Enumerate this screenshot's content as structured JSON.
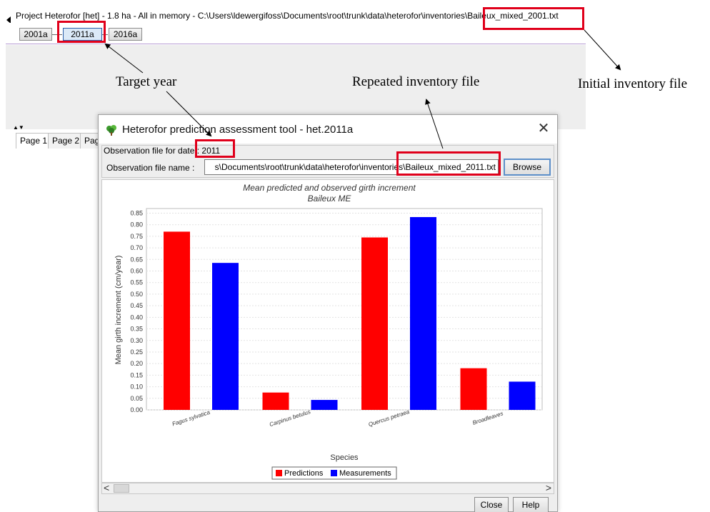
{
  "main_window": {
    "title": "Project Heterofor [het] - 1.8 ha - All in memory - C:\\Users\\ldewergifoss\\Documents\\root\\trunk\\data\\heterofor\\inventories\\Baileux_mixed_2001.txt",
    "steps": [
      "2001a",
      "2011a",
      "2016a"
    ],
    "page_tabs": [
      "Page 1",
      "Page 2",
      "Pag"
    ]
  },
  "annotations": {
    "target_year": "Target year",
    "repeated_file": "Repeated inventory file",
    "initial_file": "Initial inventory file"
  },
  "dialog": {
    "title": "Heterofor prediction assessment tool - het.2011a",
    "close_glyph": "✕",
    "obs_date_label": "Observation file for date",
    "obs_date_value": ": 2011",
    "obs_name_label": "Observation file name :",
    "obs_name_value": "s\\Documents\\root\\trunk\\data\\heterofor\\inventories\\Baileux_mixed_2011.txt",
    "browse_label": "Browse",
    "close_label": "Close",
    "help_label": "Help",
    "scroll_left": "<",
    "scroll_right": ">"
  },
  "icons": {
    "app": "tree-icon",
    "close": "close-icon"
  },
  "colors": {
    "predictions": "#ff0000",
    "measurements": "#0000ff",
    "annotation_box": "#e0001b"
  },
  "chart_data": {
    "type": "bar",
    "title": "Mean predicted and observed girth increment",
    "subtitle": "Baileux ME",
    "xlabel": "Species",
    "ylabel": "Mean girth increment (cm/year)",
    "ylim": [
      0,
      0.87
    ],
    "yticks": [
      "0.00",
      "0.05",
      "0.10",
      "0.15",
      "0.20",
      "0.25",
      "0.30",
      "0.35",
      "0.40",
      "0.45",
      "0.50",
      "0.55",
      "0.60",
      "0.65",
      "0.70",
      "0.75",
      "0.80",
      "0.85"
    ],
    "categories": [
      "Fagus sylvatica",
      "Carpinus betulus",
      "Quercus petraea",
      "Broadleaves"
    ],
    "series": [
      {
        "name": "Predictions",
        "values": [
          0.77,
          0.075,
          0.745,
          0.18
        ]
      },
      {
        "name": "Measurements",
        "values": [
          0.635,
          0.043,
          0.833,
          0.122
        ]
      }
    ],
    "grid": true,
    "legend": "bottom"
  }
}
